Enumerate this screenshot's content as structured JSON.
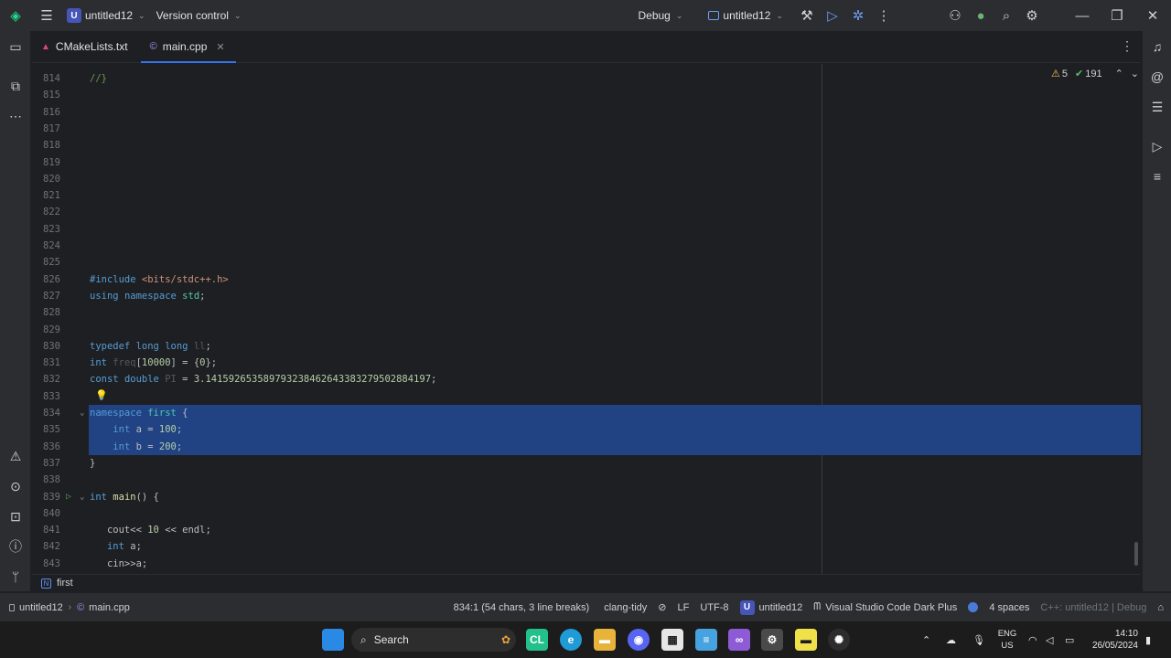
{
  "titlebar": {
    "project_badge": "U",
    "project_name": "untitled12",
    "vcs_label": "Version control",
    "run_config": "Debug",
    "target_name": "untitled12"
  },
  "tabs": [
    {
      "label": "CMakeLists.txt",
      "active": false
    },
    {
      "label": "main.cpp",
      "active": true
    }
  ],
  "editor": {
    "inspections": {
      "warnings": "5",
      "passed": "191"
    },
    "lines": [
      {
        "num": "814",
        "text": "//}"
      },
      {
        "num": "815",
        "text": ""
      },
      {
        "num": "816",
        "text": ""
      },
      {
        "num": "817",
        "text": ""
      },
      {
        "num": "818",
        "text": ""
      },
      {
        "num": "819",
        "text": ""
      },
      {
        "num": "820",
        "text": ""
      },
      {
        "num": "821",
        "text": ""
      },
      {
        "num": "822",
        "text": ""
      },
      {
        "num": "823",
        "text": ""
      },
      {
        "num": "824",
        "text": ""
      },
      {
        "num": "825",
        "text": ""
      },
      {
        "num": "826",
        "text": "#include <bits/stdc++.h>"
      },
      {
        "num": "827",
        "text": "using namespace std;"
      },
      {
        "num": "828",
        "text": ""
      },
      {
        "num": "829",
        "text": ""
      },
      {
        "num": "830",
        "text": "typedef long long ll;"
      },
      {
        "num": "831",
        "text": "int freq[10000] = {0};"
      },
      {
        "num": "832",
        "text": "const double PI = 3.14159265358979323846264338327950288419​7;"
      },
      {
        "num": "833",
        "text": ""
      },
      {
        "num": "834",
        "text": "namespace first {"
      },
      {
        "num": "835",
        "text": "    int a = 100;"
      },
      {
        "num": "836",
        "text": "    int b = 200;"
      },
      {
        "num": "837",
        "text": "}"
      },
      {
        "num": "838",
        "text": ""
      },
      {
        "num": "839",
        "text": "int main() {"
      },
      {
        "num": "840",
        "text": ""
      },
      {
        "num": "841",
        "text": "   cout<< 10 << endl;"
      },
      {
        "num": "842",
        "text": "   int a;"
      },
      {
        "num": "843",
        "text": "   cin>>a;"
      }
    ]
  },
  "breadcrumb": {
    "badge": "N",
    "label": "first"
  },
  "statusbar": {
    "project": "untitled12",
    "file": "main.cpp",
    "position": "834:1 (54 chars, 3 line breaks)",
    "linter": "clang-tidy",
    "line_sep": "LF",
    "encoding": "UTF-8",
    "project_badge": "U",
    "project_name": "untitled12",
    "theme": "Visual Studio Code Dark Plus",
    "indent": "4 spaces",
    "context": "C++: untitled12 | Debug"
  },
  "taskbar": {
    "search_label": "Search",
    "lang_top": "ENG",
    "lang_bottom": "US",
    "time": "14:10",
    "date": "26/05/2024"
  },
  "colors": {
    "accent": "#3574f0",
    "selection": "#214283",
    "editor_bg": "#1e1f22",
    "panel_bg": "#2b2d30"
  }
}
